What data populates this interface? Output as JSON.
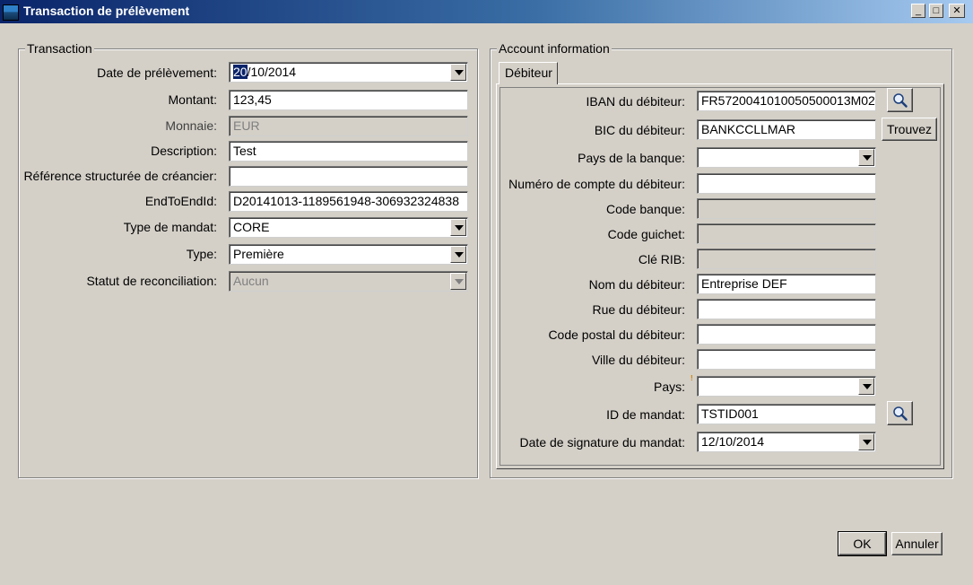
{
  "window": {
    "title": "Transaction de prélèvement",
    "minimize_icon": "minimize-icon",
    "maximize_icon": "maximize-icon",
    "close_icon": "close-icon",
    "minimize_glyph": "_",
    "maximize_glyph": "□",
    "close_glyph": "✕"
  },
  "transaction": {
    "legend": "Transaction",
    "date_label": "Date de prélèvement:",
    "date_value_selected": "20",
    "date_value_rest": "/10/2014",
    "montant_label": "Montant:",
    "montant_value": "123,45",
    "monnaie_label": "Monnaie:",
    "monnaie_value": "EUR",
    "description_label": "Description:",
    "description_value": "Test",
    "reference_label": "Référence structurée de créancier:",
    "reference_value": "",
    "endtoend_label": "EndToEndId:",
    "endtoend_value": "D20141013-1189561948-306932324838",
    "type_mandat_label": "Type de mandat:",
    "type_mandat_value": "CORE",
    "type_label": "Type:",
    "type_value": "Première",
    "statut_label": "Statut de reconciliation:",
    "statut_value": "Aucun"
  },
  "account": {
    "legend": "Account information",
    "tab_label": "Débiteur",
    "iban_label": "IBAN du débiteur:",
    "iban_value": "FR5720041010050500013M02",
    "bic_label": "BIC du débiteur:",
    "bic_value": "BANKCCLLMAR",
    "trouvez_label": "Trouvez",
    "pays_banque_label": "Pays de la banque:",
    "pays_banque_value": "",
    "numero_compte_label": "Numéro de compte du débiteur:",
    "numero_compte_value": "",
    "code_banque_label": "Code banque:",
    "code_guichet_label": "Code guichet:",
    "cle_rib_label": "Clé RIB:",
    "nom_label": "Nom du débiteur:",
    "nom_value": "Entreprise DEF",
    "rue_label": "Rue du débiteur:",
    "rue_value": "",
    "code_postal_label": "Code postal du débiteur:",
    "code_postal_value": "",
    "ville_label": "Ville du débiteur:",
    "ville_value": "",
    "pays_label": "Pays:",
    "pays_value": "",
    "id_mandat_label": "ID de mandat:",
    "id_mandat_value": "TSTID001",
    "date_signature_label": "Date de signature du mandat:",
    "date_signature_value": "12/10/2014"
  },
  "footer": {
    "ok_label": "OK",
    "annuler_label": "Annuler"
  },
  "icons": {
    "search": "magnifier-icon",
    "dropdown": "chevron-down-icon",
    "warning": "warning-icon"
  }
}
